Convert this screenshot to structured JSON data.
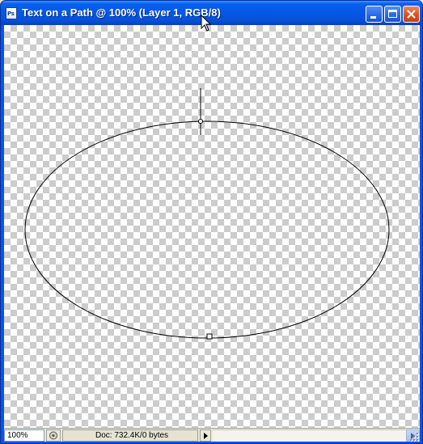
{
  "window": {
    "title": "Text on a Path @ 100% (Layer 1, RGB/8)",
    "app_icon": "photoshop-document-icon",
    "app_icon_text": "Ps",
    "controls": {
      "minimize_icon": "minimize-icon",
      "maximize_icon": "maximize-icon",
      "close_icon": "close-icon"
    }
  },
  "canvas": {
    "background": "transparent-checkerboard",
    "shape": "ellipse-path",
    "stroke_color": "#000000"
  },
  "status_bar": {
    "zoom": "100%",
    "doc_info": "Doc: 732.4K/0 bytes",
    "status_icon": "status-menu-icon",
    "doc_menu_icon": "triangle-right-icon"
  },
  "colors": {
    "title_bar": "#0a54e3",
    "close_button": "#d9541f"
  }
}
